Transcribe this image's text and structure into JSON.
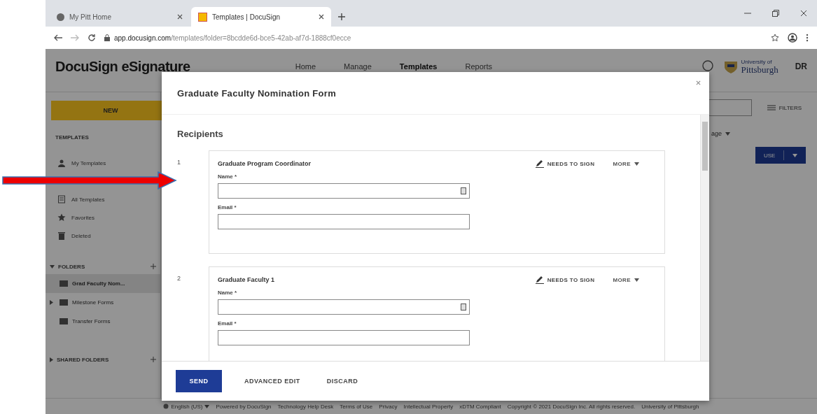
{
  "browser": {
    "tabs": [
      {
        "title": "My Pitt Home",
        "selected": false
      },
      {
        "title": "Templates | DocuSign",
        "selected": true
      }
    ],
    "url_host": "app.docusign.com",
    "url_path": "/templates/folder=8bcdde6d-bce5-42ab-af7d-1888cf0ecce"
  },
  "app": {
    "logo": "DocuSign eSignature",
    "nav": [
      {
        "label": "Home",
        "selected": false
      },
      {
        "label": "Manage",
        "selected": false
      },
      {
        "label": "Templates",
        "selected": true
      },
      {
        "label": "Reports",
        "selected": false
      }
    ],
    "university": {
      "line1": "University of",
      "line2": "Pittsburgh"
    },
    "avatar": "DR"
  },
  "sidebar": {
    "new_button": "NEW",
    "templates_heading": "TEMPLATES",
    "items": [
      {
        "label": "My Templates"
      },
      {
        "label": "All Templates"
      },
      {
        "label": "Favorites"
      },
      {
        "label": "Deleted"
      }
    ],
    "folders_heading": "FOLDERS",
    "folders_expanded": true,
    "folders": [
      {
        "label": "Grad Faculty Nom...",
        "selected": true,
        "expandable": false
      },
      {
        "label": "Milestone Forms",
        "selected": false,
        "expandable": true
      },
      {
        "label": "Transfer Forms",
        "selected": false,
        "expandable": false
      }
    ],
    "shared_heading": "SHARED FOLDERS"
  },
  "list": {
    "filters": "FILTERS",
    "column": "age",
    "use_button": "USE"
  },
  "modal": {
    "title": "Graduate Faculty Nomination Form",
    "section": "Recipients",
    "recipients": [
      {
        "number": "1",
        "role": "Graduate Program Coordinator",
        "name_label": "Name *",
        "email_label": "Email *",
        "action": "NEEDS TO SIGN",
        "more": "MORE"
      },
      {
        "number": "2",
        "role": "Graduate Faculty 1",
        "name_label": "Name *",
        "email_label": "Email *",
        "action": "NEEDS TO SIGN",
        "more": "MORE"
      }
    ],
    "buttons": [
      {
        "label": "SEND",
        "kind": "primary"
      },
      {
        "label": "ADVANCED EDIT",
        "kind": "text"
      },
      {
        "label": "DISCARD",
        "kind": "text"
      }
    ]
  },
  "footer": {
    "language": "English (US)",
    "links": [
      "Powered by DocuSign",
      "Technology Help Desk",
      "Terms of Use",
      "Privacy",
      "Intellectual Property",
      "xDTM Compliant",
      "Copyright © 2021 DocuSign Inc. All rights reserved.",
      "University of Pittsburgh"
    ]
  }
}
